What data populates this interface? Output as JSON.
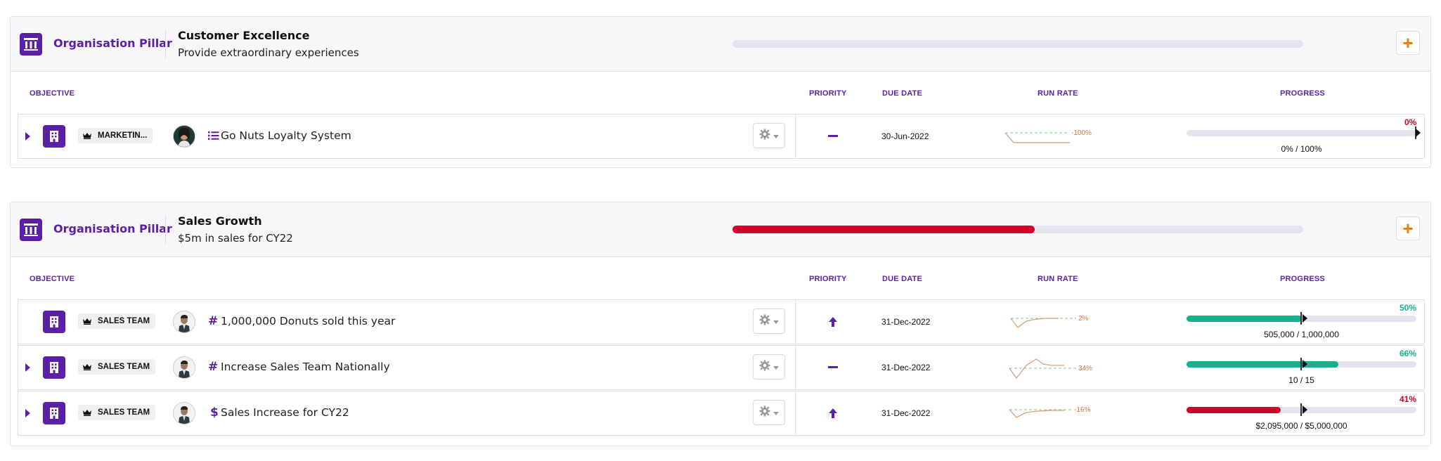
{
  "colors": {
    "purple": "#5b1fa8",
    "red": "#d0042b",
    "green": "#12b28c",
    "orange": "#ef7d00",
    "runrate": "#d07840"
  },
  "column_headers": {
    "objective": "OBJECTIVE",
    "priority": "PRIORITY",
    "due_date": "DUE DATE",
    "run_rate": "RUN RATE",
    "progress": "PROGRESS"
  },
  "pillars": [
    {
      "label": "Organisation Pillar",
      "icon": "pillar-icon",
      "title": "Customer Excellence",
      "subtitle": "Provide extraordinary experiences",
      "progress": 0,
      "add_label": "+",
      "objectives": [
        {
          "expandable": true,
          "team": "MARKETIN...",
          "avatar": "avatar-woman",
          "type_icon": "list-icon",
          "name": "Go Nuts Loyalty System",
          "priority": "minus-icon",
          "due_date": "30-Jun-2022",
          "run_rate": "-100%",
          "percent": "0%",
          "percent_value": 0,
          "expected": 1.0,
          "status_color": "#d0042b",
          "progress_text": "0% / 100%"
        }
      ]
    },
    {
      "label": "Organisation Pillar",
      "icon": "pillar-icon",
      "title": "Sales Growth",
      "subtitle": "$5m in sales for CY22",
      "progress": 0.53,
      "add_label": "+",
      "objectives": [
        {
          "expandable": false,
          "team": "SALES TEAM",
          "avatar": "avatar-man",
          "type_icon": "hash-icon",
          "name": "1,000,000 Donuts sold this year",
          "priority": "arrow-up-icon",
          "due_date": "31-Dec-2022",
          "run_rate": "2%",
          "percent": "50%",
          "percent_value": 0.5,
          "expected": 0.5,
          "status_color": "#12b28c",
          "progress_text": "505,000 / 1,000,000"
        },
        {
          "expandable": true,
          "team": "SALES TEAM",
          "avatar": "avatar-man",
          "type_icon": "hash-icon",
          "name": "Increase Sales Team Nationally",
          "priority": "minus-icon",
          "due_date": "31-Dec-2022",
          "run_rate": "34%",
          "percent": "66%",
          "percent_value": 0.66,
          "expected": 0.5,
          "status_color": "#12b28c",
          "progress_text": "10 / 15"
        },
        {
          "expandable": true,
          "team": "SALES TEAM",
          "avatar": "avatar-man",
          "type_icon": "dollar-icon",
          "name": "Sales Increase for CY22",
          "priority": "arrow-up-icon",
          "due_date": "31-Dec-2022",
          "run_rate": "-16%",
          "percent": "41%",
          "percent_value": 0.41,
          "expected": 0.5,
          "status_color": "#d0042b",
          "progress_text": "$2,095,000 / $5,000,000"
        }
      ]
    }
  ]
}
